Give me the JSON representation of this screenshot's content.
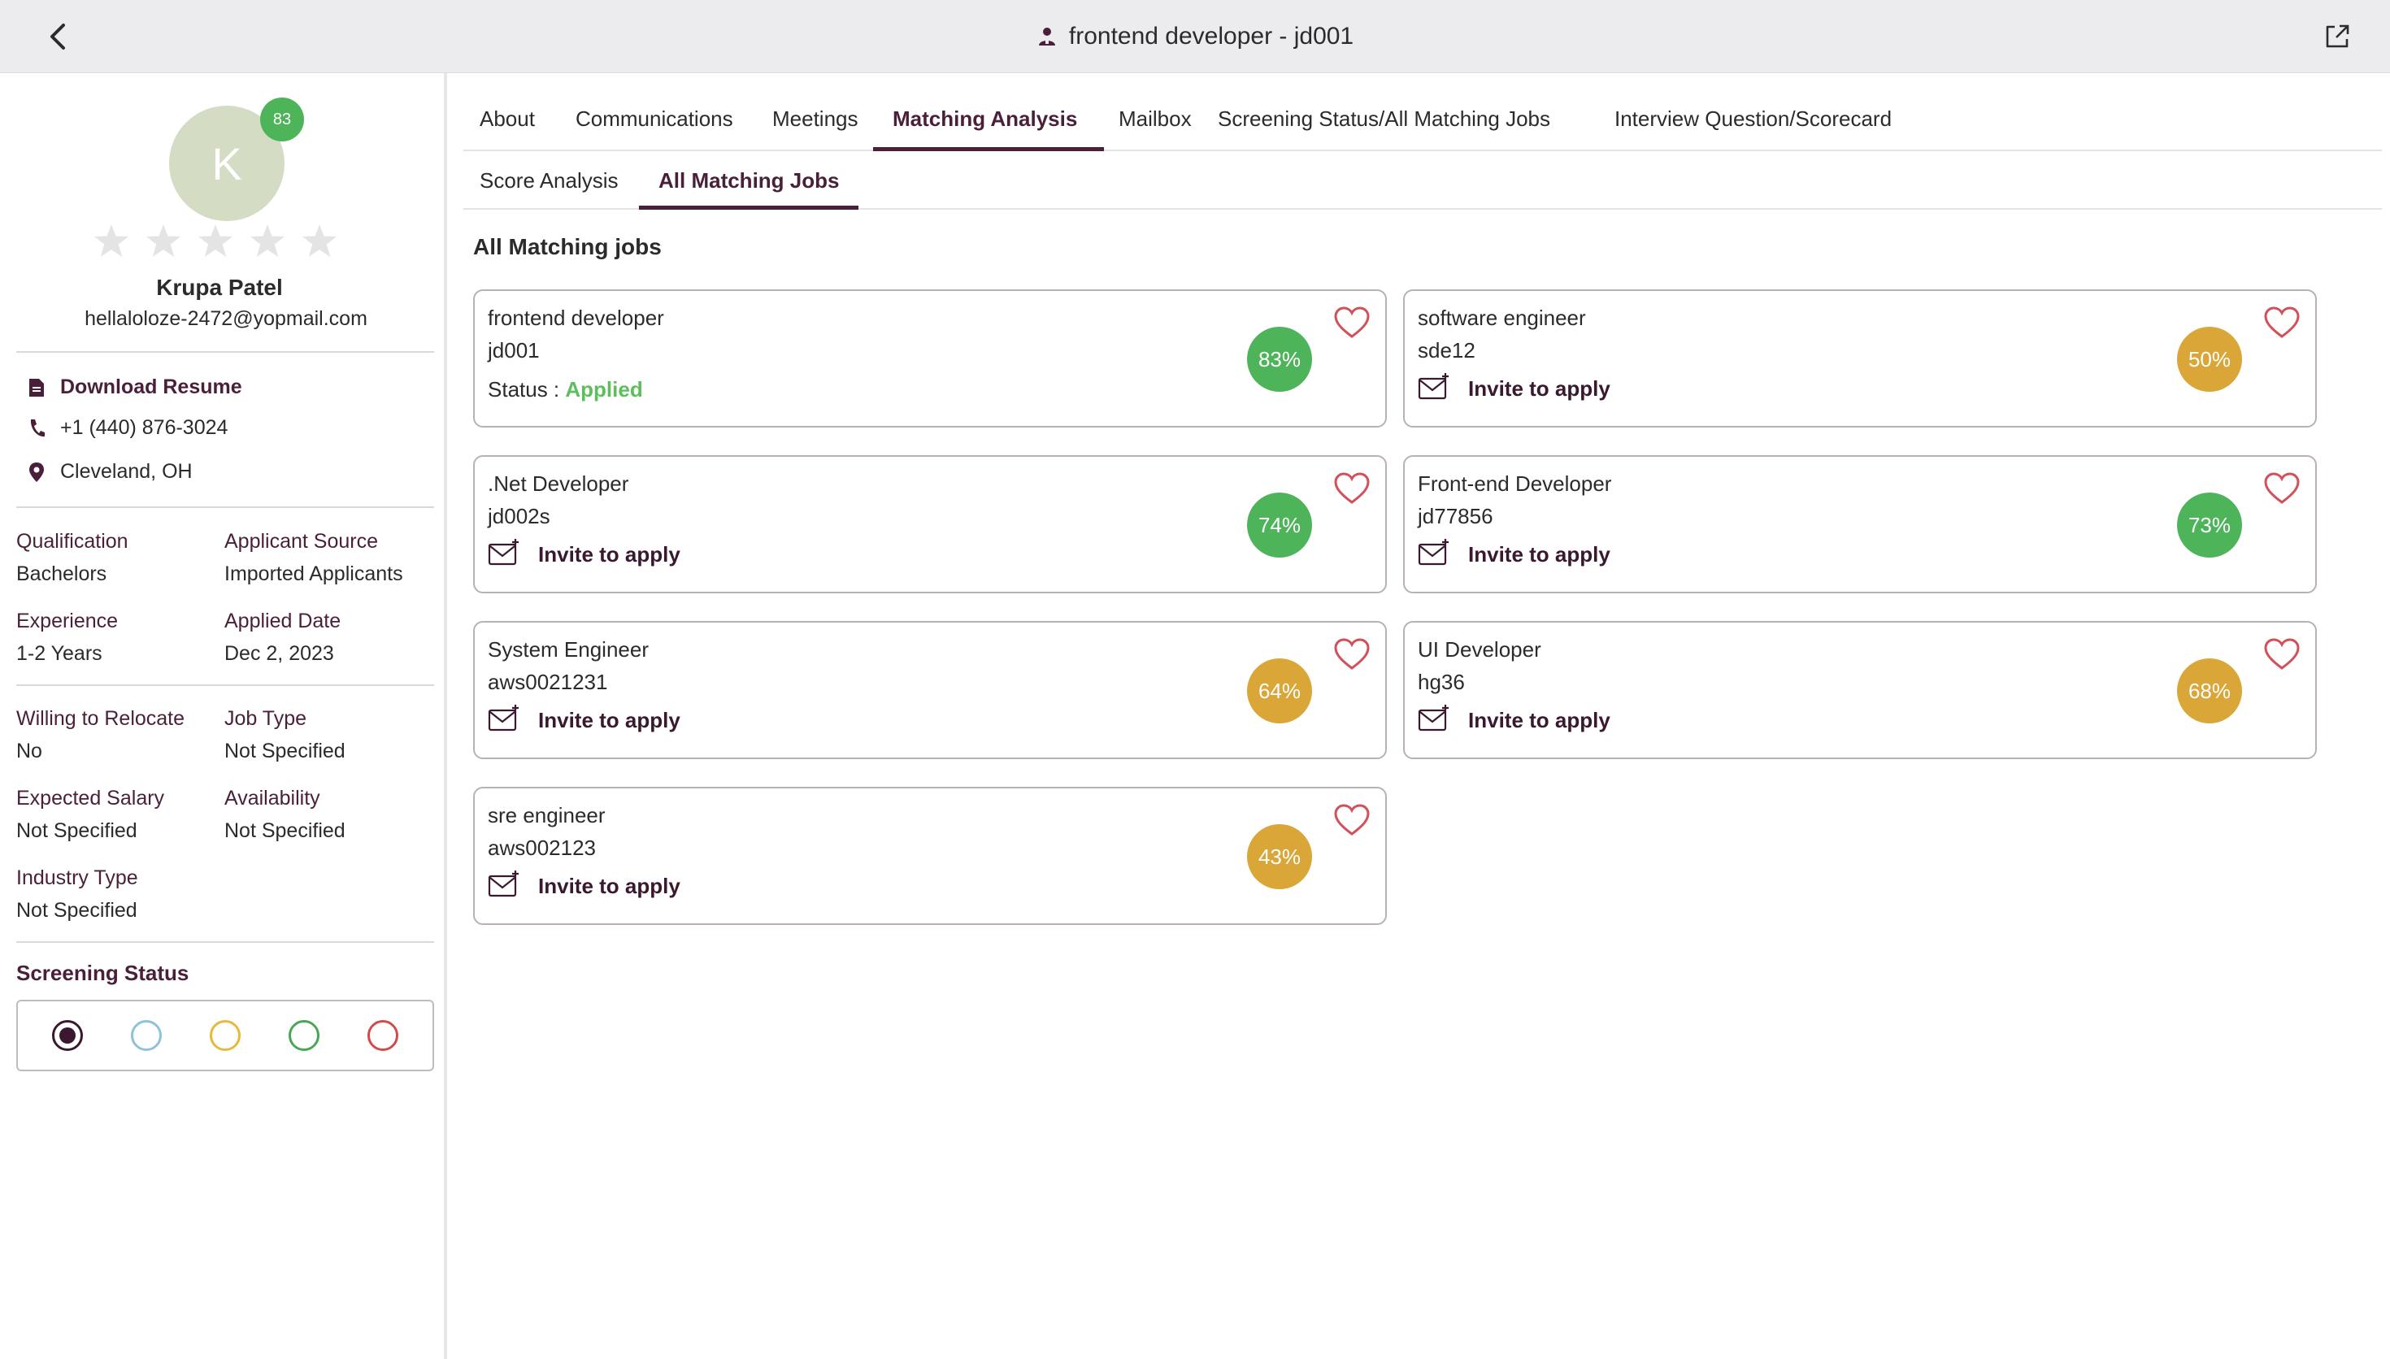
{
  "header": {
    "title": "frontend developer - jd001",
    "back_icon": "chevron-left-icon",
    "external_icon": "external-link-icon"
  },
  "candidate": {
    "initial": "K",
    "badge": "83",
    "name": "Krupa Patel",
    "email": "hellaloloze-2472@yopmail.com",
    "download_resume": "Download Resume",
    "phone": "+1 (440) 876-3024",
    "location": "Cleveland, OH",
    "rating": 0,
    "details": [
      {
        "label": "Qualification",
        "value": "Bachelors"
      },
      {
        "label": "Applicant Source",
        "value": "Imported Applicants"
      },
      {
        "label": "Experience",
        "value": "1-2 Years"
      },
      {
        "label": "Applied Date",
        "value": "Dec 2, 2023"
      },
      {
        "label": "Willing to Relocate",
        "value": "No"
      },
      {
        "label": "Job Type",
        "value": "Not Specified"
      },
      {
        "label": "Expected Salary",
        "value": "Not Specified"
      },
      {
        "label": "Availability",
        "value": "Not Specified"
      },
      {
        "label": "Industry Type",
        "value": "Not Specified"
      }
    ],
    "screening_title": "Screening Status",
    "screening_colors": [
      "#3a1830",
      "#8ec2dc",
      "#e6b93b",
      "#4aa655",
      "#d44a4a"
    ]
  },
  "tabs": [
    {
      "label": "About"
    },
    {
      "label": "Communications"
    },
    {
      "label": "Meetings"
    },
    {
      "label": "Matching Analysis",
      "active": true
    },
    {
      "label": "Mailbox"
    },
    {
      "label": "Screening Status/All Matching Jobs"
    },
    {
      "label": "Interview Question/Scorecard"
    }
  ],
  "subtabs": [
    {
      "label": "Score Analysis"
    },
    {
      "label": "All Matching Jobs",
      "active": true
    }
  ],
  "section_title": "All Matching jobs",
  "invite_label": "Invite to apply",
  "status_label": "Status : ",
  "colors": {
    "green": "#4db45a",
    "amber": "#daa637",
    "heart": "#d2505a",
    "brand": "#4a1f3a"
  },
  "jobs": [
    {
      "title": "frontend developer",
      "id": "jd001",
      "score": "83%",
      "color": "green",
      "status": "Applied"
    },
    {
      "title": "software engineer",
      "id": "sde12",
      "score": "50%",
      "color": "amber"
    },
    {
      "title": ".Net Developer",
      "id": "jd002s",
      "score": "74%",
      "color": "green"
    },
    {
      "title": "Front-end Developer",
      "id": "jd77856",
      "score": "73%",
      "color": "green"
    },
    {
      "title": "System Engineer",
      "id": "aws0021231",
      "score": "64%",
      "color": "amber"
    },
    {
      "title": "UI Developer",
      "id": "hg36",
      "score": "68%",
      "color": "amber"
    },
    {
      "title": "sre engineer",
      "id": "aws002123",
      "score": "43%",
      "color": "amber"
    }
  ]
}
